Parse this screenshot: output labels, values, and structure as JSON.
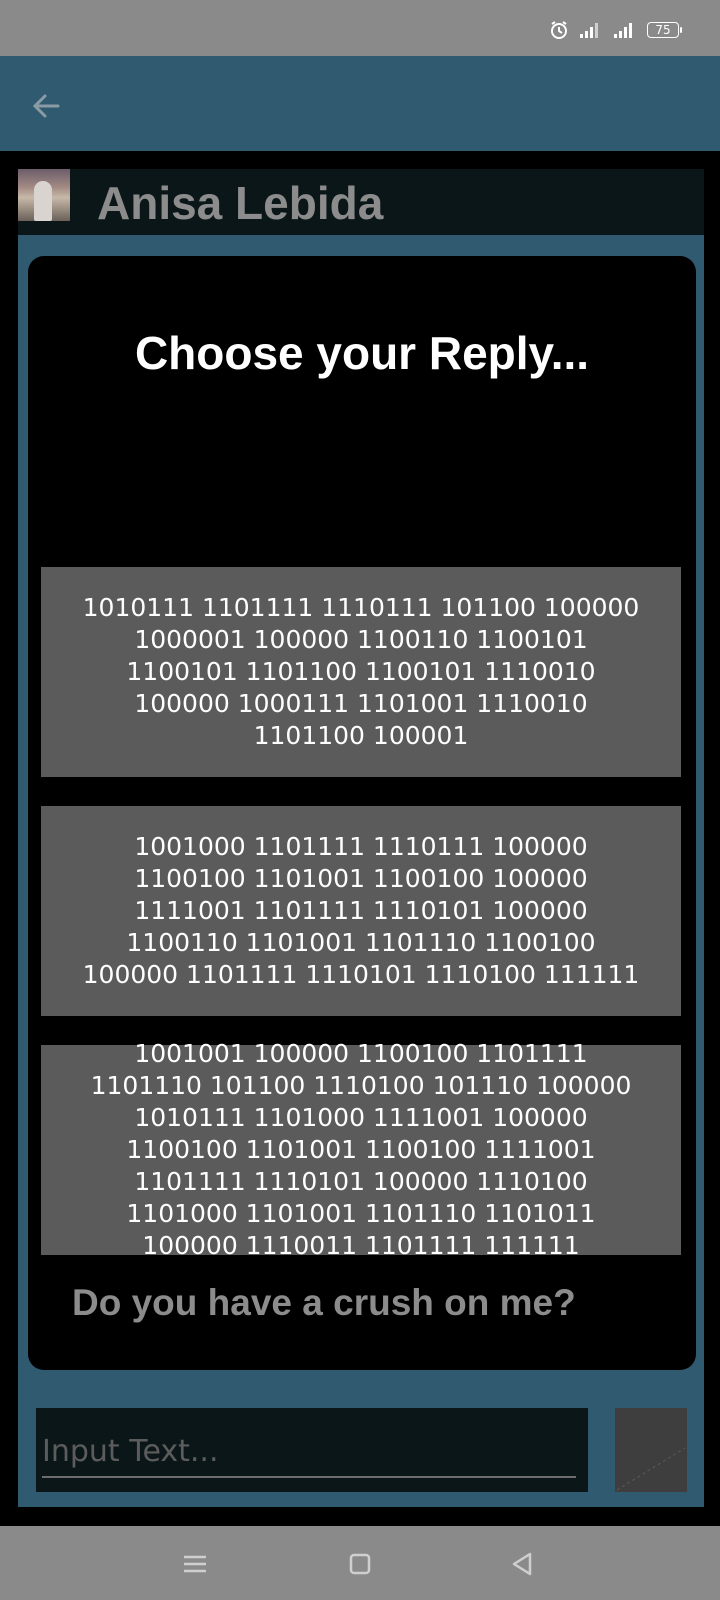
{
  "status_bar": {
    "battery": "75",
    "icons": [
      "alarm-icon",
      "signal-icon",
      "signal-icon",
      "battery-icon"
    ]
  },
  "app_bar": {
    "back_icon": "arrow-back-icon"
  },
  "profile": {
    "name": "Anisa Lebida"
  },
  "dialog": {
    "title": "Choose your Reply...",
    "replies": [
      "1010111 1101111 1110111 101100 100000 1000001 100000 1100110 1100101 1100101 1101100 1100101 1110010 100000 1000111 1101001 1110010 1101100 100001",
      "1001000 1101111 1110111 100000 1100100 1101001 1100100 100000 1111001 1101111 1110101 100000 1100110 1101001 1101110 1100100 100000 1101111 1110101 1110100 111111",
      "1001001 100000 1100100 1101111 1101110 101100 1110100 101110 100000 1010111 1101000 1111001 100000 1100100 1101001 1100100 1111001 1101111 1110101 100000 1110100 1101000 1101001 1101110 1101011 100000 1110011 1101111 111111"
    ],
    "question": "Do you have a crush on me?"
  },
  "composer": {
    "placeholder": "Input Text..."
  },
  "nav_bar": {
    "icons": [
      "menu-icon",
      "home-square-icon",
      "back-triangle-icon"
    ]
  },
  "colors": {
    "app_bar": "#2f5a70",
    "status_bar": "#8a8a8a",
    "reply_button": "#5b5b5c",
    "dialog_bg": "#000000"
  }
}
